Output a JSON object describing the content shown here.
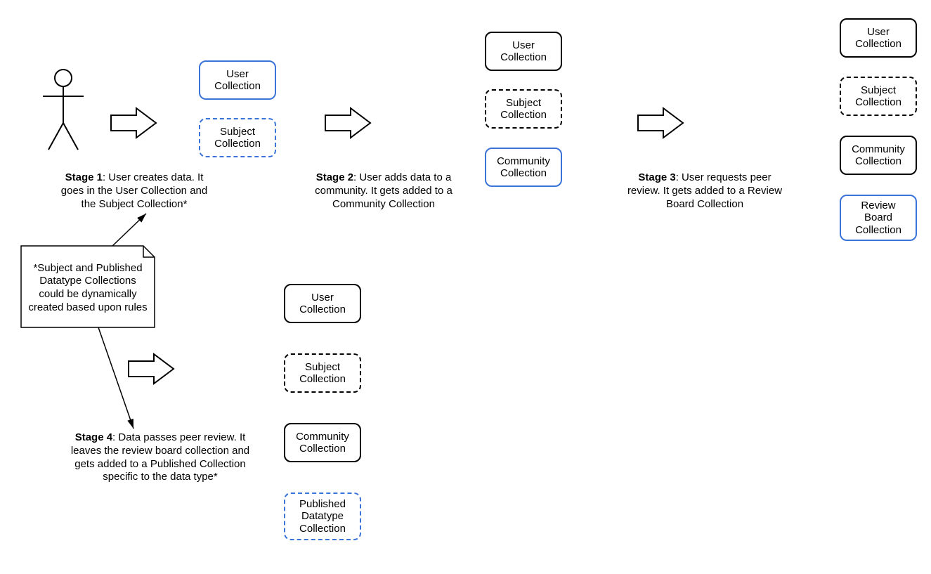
{
  "labels": {
    "user_collection": "User\nCollection",
    "subject_collection": "Subject\nCollection",
    "community_collection": "Community\nCollection",
    "review_board_collection": "Review\nBoard\nCollection",
    "published_datatype_collection": "Published\nDatatype\nCollection"
  },
  "stages": {
    "s1_bold": "Stage 1",
    "s1_rest": ": User creates data. It goes in the User Collection and the Subject Collection*",
    "s2_bold": "Stage 2",
    "s2_rest": ": User adds data to a community. It gets added to a Community Collection",
    "s3_bold": "Stage 3",
    "s3_rest": ": User requests peer review. It gets added to a Review Board Collection",
    "s4_bold": "Stage 4",
    "s4_rest": ": Data passes peer review. It leaves the review board collection and gets added to a Published Collection specific to the data type*"
  },
  "note": "*Subject and Published Datatype Collections could be dynamically created based upon rules"
}
